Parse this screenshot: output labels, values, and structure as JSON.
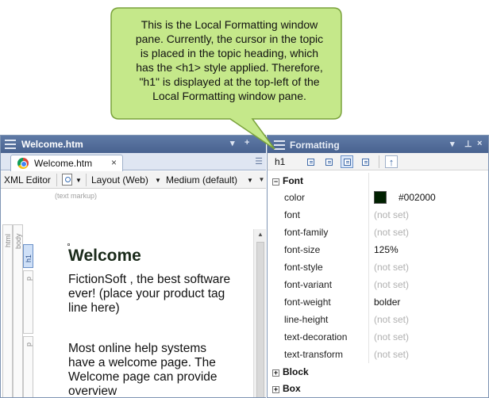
{
  "callout": {
    "lines": [
      "This is the Local Formatting window",
      "pane. Currently, the cursor in the topic",
      "is placed in the topic heading, which",
      "has the <h1> style applied. Therefore,",
      "\"h1\" is displayed at the top-left of the",
      "Local Formatting window pane."
    ],
    "fill": "#c5e88a",
    "stroke": "#7aa23c"
  },
  "editor": {
    "window_title": "Welcome.htm",
    "title_controls": [
      "▾",
      "+"
    ],
    "tab_label": "Welcome.htm",
    "tab_close": "×",
    "toolbar": {
      "xml_editor": "XML Editor",
      "layout": "Layout (Web)",
      "medium": "Medium (default)"
    },
    "text_markup_label": "(text markup)",
    "tags": {
      "html": "html",
      "body": "body",
      "h1": "h1",
      "p1": "p",
      "p2": "p"
    },
    "heading": "Welcome",
    "paragraphs": [
      "FictionSoft , the best software ever! (place your product tag line here)",
      "Most online help systems have a welcome page. The Welcome page can provide overview"
    ]
  },
  "formatting": {
    "window_title": "Formatting",
    "title_controls": [
      "▾",
      "⊥",
      "×"
    ],
    "style_name": "h1",
    "sections": {
      "font": "Font",
      "block": "Block",
      "box": "Box"
    },
    "color_hex": "#002000",
    "properties": [
      {
        "name": "color",
        "value": "#002000",
        "is_color": true
      },
      {
        "name": "font",
        "value": "(not set)",
        "unset": true
      },
      {
        "name": "font-family",
        "value": "(not set)",
        "unset": true
      },
      {
        "name": "font-size",
        "value": "125%",
        "unset": false
      },
      {
        "name": "font-style",
        "value": "(not set)",
        "unset": true
      },
      {
        "name": "font-variant",
        "value": "(not set)",
        "unset": true
      },
      {
        "name": "font-weight",
        "value": "bolder",
        "unset": false
      },
      {
        "name": "line-height",
        "value": "(not set)",
        "unset": true
      },
      {
        "name": "text-decoration",
        "value": "(not set)",
        "unset": true
      },
      {
        "name": "text-transform",
        "value": "(not set)",
        "unset": true
      }
    ]
  },
  "colors": {
    "title_bar": "#48628f",
    "tab_bar": "#dfe6f2",
    "unset_text": "#b0b0b0"
  }
}
